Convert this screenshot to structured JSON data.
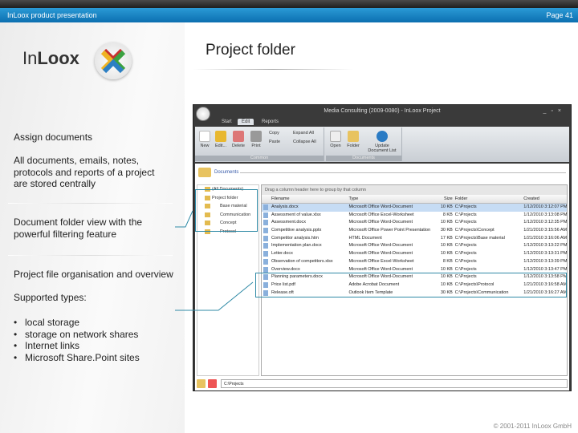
{
  "header": {
    "presentation_title": "InLoox product presentation",
    "page": "Page 41"
  },
  "logo": {
    "text_light": "In",
    "text_bold": "Loox"
  },
  "slide": {
    "title": "Project folder",
    "assign": "Assign documents",
    "all_docs": "All documents, emails, notes, protocols and reports of a project are stored centrally",
    "folder_view": "Document folder view with the powerful filtering feature",
    "organisation": "Project file organisation and overview",
    "supported": "Supported types:",
    "types": [
      "local storage",
      "storage on network shares",
      "Internet links",
      "Microsoft Share.Point sites"
    ]
  },
  "footer": "© 2001-2011 InLoox GmbH",
  "app": {
    "window_title": "Media Consulting (2009-0080) - InLoox Project",
    "tabs": [
      "Start",
      "Edit",
      "Reports"
    ],
    "ribbon": {
      "new": "New",
      "edit": "Edit...",
      "delete": "Delete",
      "print": "Print",
      "copy": "Copy",
      "paste": "Paste",
      "expand_all": "Expand All",
      "collapse_all": "Collapse All",
      "common": "Common",
      "open": "Open",
      "folder": "Folder",
      "update": "Update Document List",
      "documents_group": "Documents"
    },
    "documents_header": "Documents",
    "tree": [
      "(All Documents)",
      "Project folder",
      "Base material",
      "Communication",
      "Concept",
      "Protocol"
    ],
    "grid": {
      "drag_hint": "Drag a column header here to group by that column",
      "columns": [
        "Filename",
        "Type",
        "Size",
        "Folder",
        "Created"
      ],
      "rows": [
        [
          "Analysis.docx",
          "Microsoft Office Word-Document",
          "10 KB",
          "C:\\Projects",
          "1/12/2010 3:12:07 PM"
        ],
        [
          "Assessment of value.xlsx",
          "Microsoft Office Excel-Worksheet",
          "8 KB",
          "C:\\Projects",
          "1/12/2010 3:13:08 PM"
        ],
        [
          "Assessment.docx",
          "Microsoft Office Word-Document",
          "10 KB",
          "C:\\Projects",
          "1/12/2010 3:12:35 PM"
        ],
        [
          "Competitive analysis.pptx",
          "Microsoft Office Power Point Presentation",
          "30 KB",
          "C:\\Projects\\Concept",
          "1/21/2010 3:15:56 AM"
        ],
        [
          "Competitor analysis.htm",
          "HTML Document",
          "17 KB",
          "C:\\Projects\\Base material",
          "1/21/2010 3:16:06 AM"
        ],
        [
          "Implementation plan.docx",
          "Microsoft Office Word-Document",
          "10 KB",
          "C:\\Projects",
          "1/12/2010 3:13:22 PM"
        ],
        [
          "Letter.docx",
          "Microsoft Office Word-Document",
          "10 KB",
          "C:\\Projects",
          "1/12/2010 3:13:31 PM"
        ],
        [
          "Observation of competitors.xlsx",
          "Microsoft Office Excel-Worksheet",
          "8 KB",
          "C:\\Projects",
          "1/12/2010 3:13:39 PM"
        ],
        [
          "Overview.docx",
          "Microsoft Office Word-Document",
          "10 KB",
          "C:\\Projects",
          "1/12/2010 3:13:47 PM"
        ],
        [
          "Planning parameters.docx",
          "Microsoft Office Word-Document",
          "10 KB",
          "C:\\Projects",
          "1/12/2010 3:13:58 PM"
        ],
        [
          "Price list.pdf",
          "Adobe Acrobat Document",
          "10 KB",
          "C:\\Projects\\Protocol",
          "1/21/2010 3:16:58 AM"
        ],
        [
          "Release.oft",
          "Outlook Item Template",
          "30 KB",
          "C:\\Projects\\Communication",
          "1/21/2010 3:16:27 AM"
        ]
      ]
    },
    "path": "C:\\Projects"
  },
  "colors": {
    "accent": "#0c6fb0",
    "highlight": "#2f8aa6"
  }
}
